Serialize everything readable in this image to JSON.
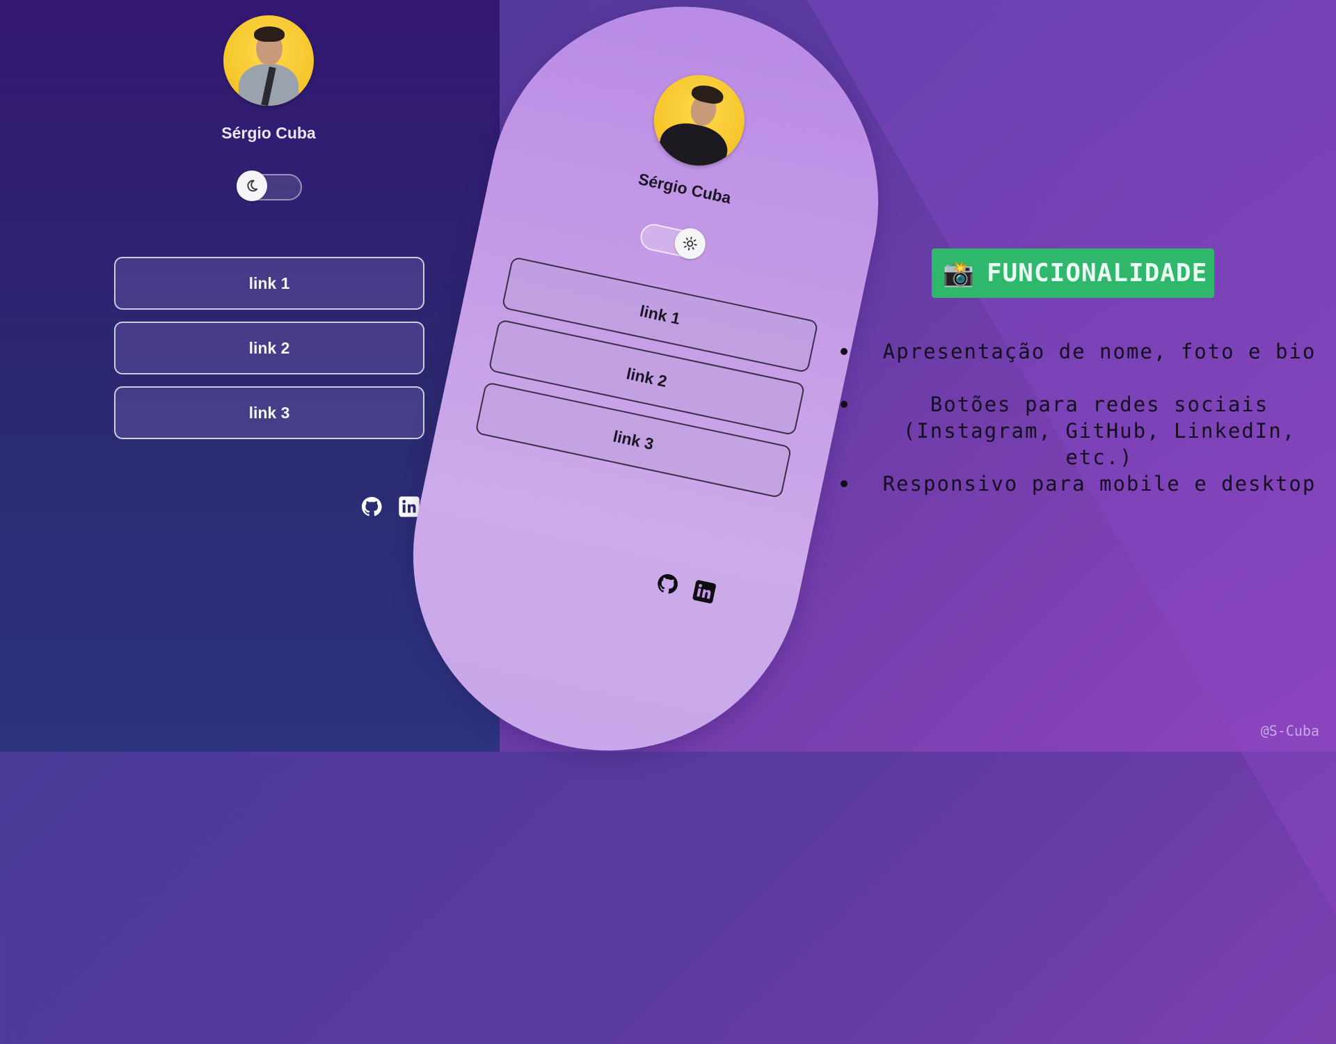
{
  "left_preview": {
    "name": "Sérgio Cuba",
    "theme_toggle_icon": "moon-icon",
    "links": [
      {
        "label": "link 1"
      },
      {
        "label": "link 2"
      },
      {
        "label": "link 3"
      }
    ],
    "social_icons": [
      "github-icon",
      "linkedin-icon"
    ]
  },
  "phone_preview": {
    "name": "Sérgio Cuba",
    "theme_toggle_icon": "sun-icon",
    "links": [
      {
        "label": "link 1"
      },
      {
        "label": "link 2"
      },
      {
        "label": "link 3"
      }
    ],
    "social_icons": [
      "github-icon",
      "linkedin-icon"
    ]
  },
  "features": {
    "badge_icon": "camera-flash-icon",
    "badge_title": "FUNCIONALIDADE",
    "items": [
      "Apresentação de nome, foto e bio",
      "Botões para redes sociais (Instagram, GitHub, LinkedIn, etc.)",
      "Responsivo para mobile e desktop"
    ]
  },
  "watermark": "@S-Cuba",
  "colors": {
    "dark_panel": "#331773",
    "light_phone": "#c49ae6",
    "badge": "#2fb86c"
  }
}
